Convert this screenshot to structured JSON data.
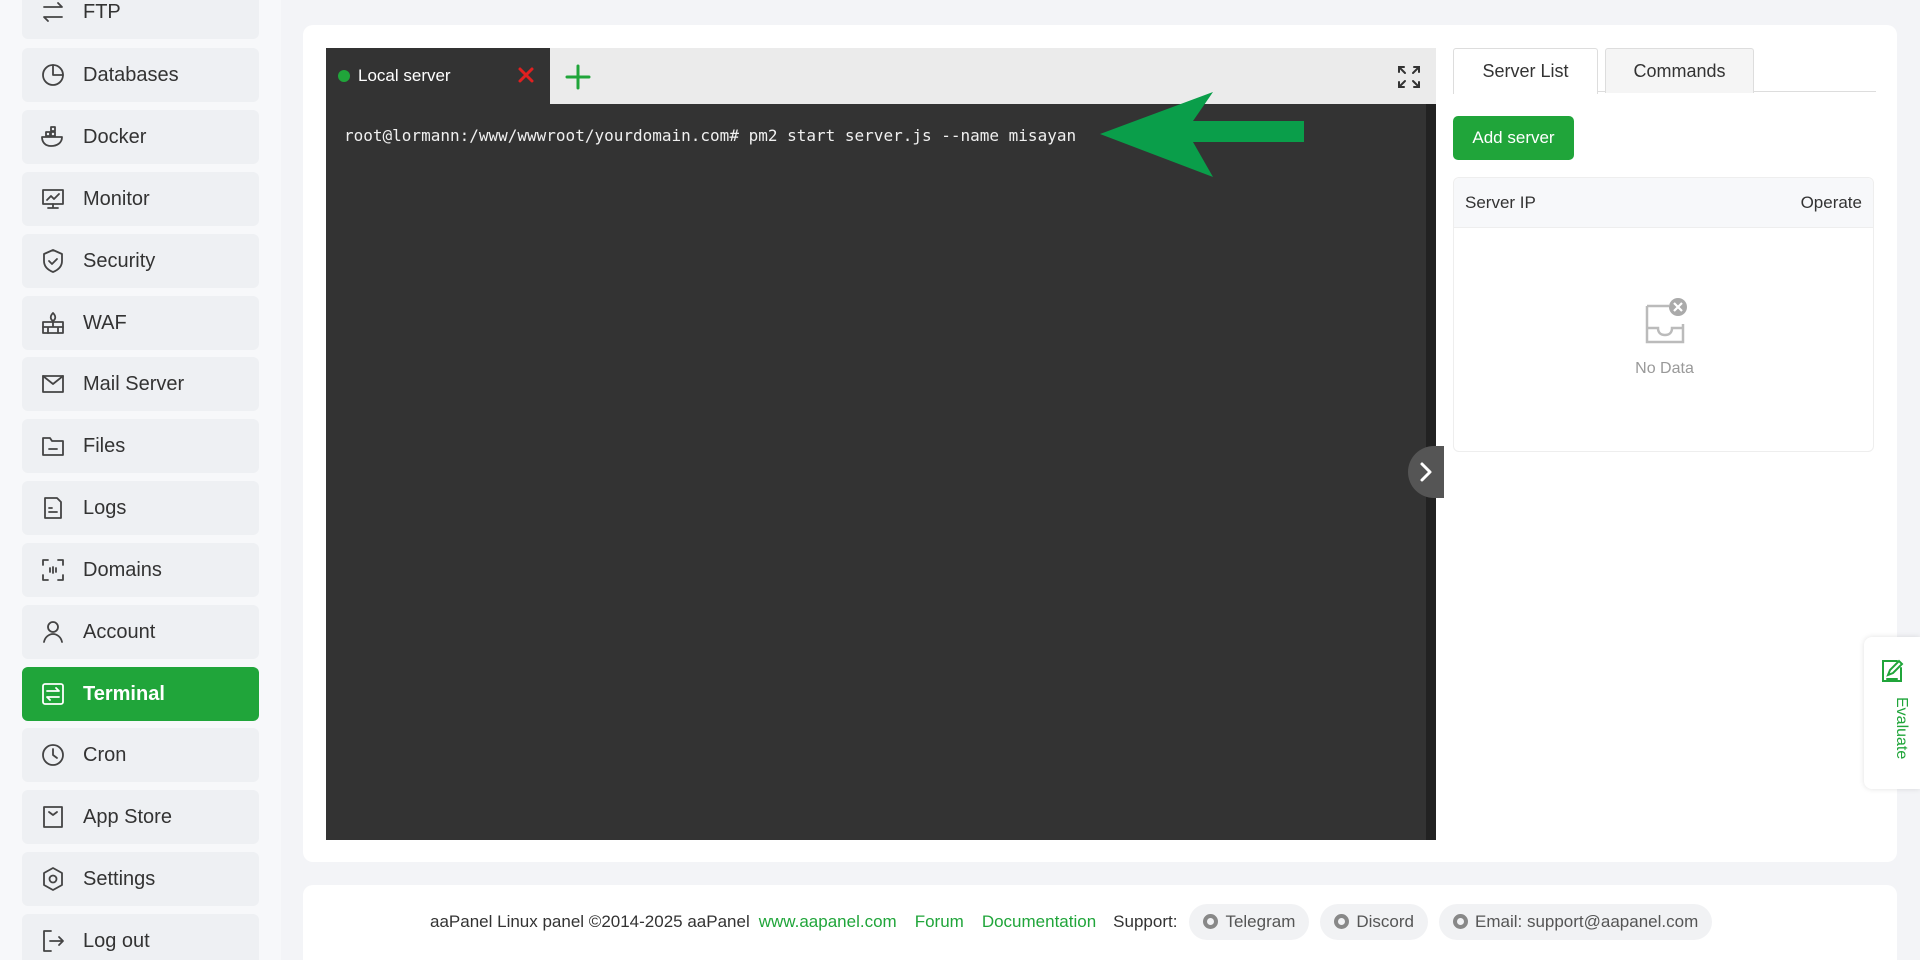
{
  "sidebar": {
    "items": [
      {
        "label": "FTP",
        "icon": "ftp-icon"
      },
      {
        "label": "Databases",
        "icon": "databases-icon"
      },
      {
        "label": "Docker",
        "icon": "docker-icon"
      },
      {
        "label": "Monitor",
        "icon": "monitor-icon"
      },
      {
        "label": "Security",
        "icon": "security-icon"
      },
      {
        "label": "WAF",
        "icon": "waf-icon"
      },
      {
        "label": "Mail Server",
        "icon": "mail-icon"
      },
      {
        "label": "Files",
        "icon": "files-icon"
      },
      {
        "label": "Logs",
        "icon": "logs-icon"
      },
      {
        "label": "Domains",
        "icon": "domains-icon"
      },
      {
        "label": "Account",
        "icon": "account-icon"
      },
      {
        "label": "Terminal",
        "icon": "terminal-icon",
        "active": true
      },
      {
        "label": "Cron",
        "icon": "cron-icon"
      },
      {
        "label": "App Store",
        "icon": "app-store-icon"
      },
      {
        "label": "Settings",
        "icon": "settings-icon"
      },
      {
        "label": "Log out",
        "icon": "logout-icon"
      }
    ]
  },
  "terminal": {
    "tab_label": "Local server",
    "status_color": "#20a53a",
    "command_line": "root@lormann:/www/wwwroot/yourdomain.com# pm2 start server.js --name misayan"
  },
  "right_panel": {
    "tabs": [
      "Server List",
      "Commands"
    ],
    "active_tab": "Server List",
    "add_server_label": "Add server",
    "columns": [
      "Server IP",
      "Operate"
    ],
    "empty_text": "No Data"
  },
  "evaluate": {
    "label": "Evaluate"
  },
  "footer": {
    "copyright": "aaPanel Linux panel ©2014-2025 aaPanel",
    "links": [
      "www.aapanel.com",
      "Forum",
      "Documentation"
    ],
    "support_label": "Support:",
    "support_items": [
      "Telegram",
      "Discord",
      "Email: support@aapanel.com"
    ]
  },
  "colors": {
    "accent": "#20a53a",
    "terminal_bg": "#333333",
    "close_red": "#e02020"
  }
}
